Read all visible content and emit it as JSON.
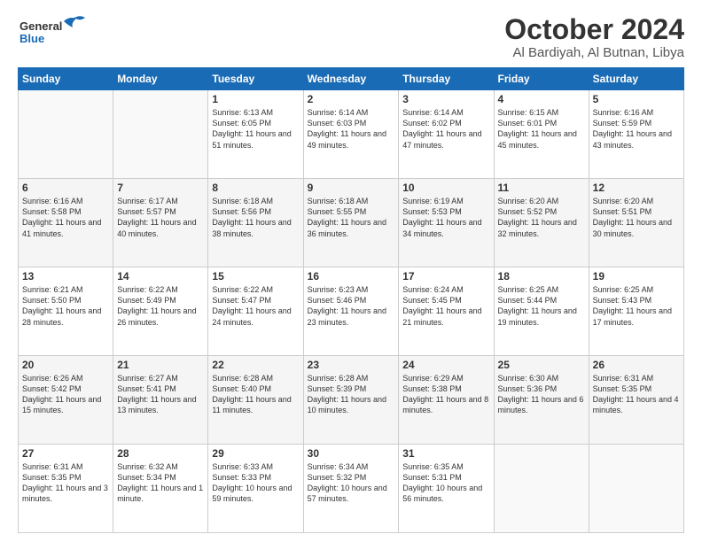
{
  "logo": {
    "line1": "General",
    "line2": "Blue",
    "icon": "▶"
  },
  "header": {
    "month": "October 2024",
    "location": "Al Bardiyah, Al Butnan, Libya"
  },
  "weekdays": [
    "Sunday",
    "Monday",
    "Tuesday",
    "Wednesday",
    "Thursday",
    "Friday",
    "Saturday"
  ],
  "weeks": [
    [
      {
        "day": "",
        "text": ""
      },
      {
        "day": "",
        "text": ""
      },
      {
        "day": "1",
        "text": "Sunrise: 6:13 AM\nSunset: 6:05 PM\nDaylight: 11 hours and 51 minutes."
      },
      {
        "day": "2",
        "text": "Sunrise: 6:14 AM\nSunset: 6:03 PM\nDaylight: 11 hours and 49 minutes."
      },
      {
        "day": "3",
        "text": "Sunrise: 6:14 AM\nSunset: 6:02 PM\nDaylight: 11 hours and 47 minutes."
      },
      {
        "day": "4",
        "text": "Sunrise: 6:15 AM\nSunset: 6:01 PM\nDaylight: 11 hours and 45 minutes."
      },
      {
        "day": "5",
        "text": "Sunrise: 6:16 AM\nSunset: 5:59 PM\nDaylight: 11 hours and 43 minutes."
      }
    ],
    [
      {
        "day": "6",
        "text": "Sunrise: 6:16 AM\nSunset: 5:58 PM\nDaylight: 11 hours and 41 minutes."
      },
      {
        "day": "7",
        "text": "Sunrise: 6:17 AM\nSunset: 5:57 PM\nDaylight: 11 hours and 40 minutes."
      },
      {
        "day": "8",
        "text": "Sunrise: 6:18 AM\nSunset: 5:56 PM\nDaylight: 11 hours and 38 minutes."
      },
      {
        "day": "9",
        "text": "Sunrise: 6:18 AM\nSunset: 5:55 PM\nDaylight: 11 hours and 36 minutes."
      },
      {
        "day": "10",
        "text": "Sunrise: 6:19 AM\nSunset: 5:53 PM\nDaylight: 11 hours and 34 minutes."
      },
      {
        "day": "11",
        "text": "Sunrise: 6:20 AM\nSunset: 5:52 PM\nDaylight: 11 hours and 32 minutes."
      },
      {
        "day": "12",
        "text": "Sunrise: 6:20 AM\nSunset: 5:51 PM\nDaylight: 11 hours and 30 minutes."
      }
    ],
    [
      {
        "day": "13",
        "text": "Sunrise: 6:21 AM\nSunset: 5:50 PM\nDaylight: 11 hours and 28 minutes."
      },
      {
        "day": "14",
        "text": "Sunrise: 6:22 AM\nSunset: 5:49 PM\nDaylight: 11 hours and 26 minutes."
      },
      {
        "day": "15",
        "text": "Sunrise: 6:22 AM\nSunset: 5:47 PM\nDaylight: 11 hours and 24 minutes."
      },
      {
        "day": "16",
        "text": "Sunrise: 6:23 AM\nSunset: 5:46 PM\nDaylight: 11 hours and 23 minutes."
      },
      {
        "day": "17",
        "text": "Sunrise: 6:24 AM\nSunset: 5:45 PM\nDaylight: 11 hours and 21 minutes."
      },
      {
        "day": "18",
        "text": "Sunrise: 6:25 AM\nSunset: 5:44 PM\nDaylight: 11 hours and 19 minutes."
      },
      {
        "day": "19",
        "text": "Sunrise: 6:25 AM\nSunset: 5:43 PM\nDaylight: 11 hours and 17 minutes."
      }
    ],
    [
      {
        "day": "20",
        "text": "Sunrise: 6:26 AM\nSunset: 5:42 PM\nDaylight: 11 hours and 15 minutes."
      },
      {
        "day": "21",
        "text": "Sunrise: 6:27 AM\nSunset: 5:41 PM\nDaylight: 11 hours and 13 minutes."
      },
      {
        "day": "22",
        "text": "Sunrise: 6:28 AM\nSunset: 5:40 PM\nDaylight: 11 hours and 11 minutes."
      },
      {
        "day": "23",
        "text": "Sunrise: 6:28 AM\nSunset: 5:39 PM\nDaylight: 11 hours and 10 minutes."
      },
      {
        "day": "24",
        "text": "Sunrise: 6:29 AM\nSunset: 5:38 PM\nDaylight: 11 hours and 8 minutes."
      },
      {
        "day": "25",
        "text": "Sunrise: 6:30 AM\nSunset: 5:36 PM\nDaylight: 11 hours and 6 minutes."
      },
      {
        "day": "26",
        "text": "Sunrise: 6:31 AM\nSunset: 5:35 PM\nDaylight: 11 hours and 4 minutes."
      }
    ],
    [
      {
        "day": "27",
        "text": "Sunrise: 6:31 AM\nSunset: 5:35 PM\nDaylight: 11 hours and 3 minutes."
      },
      {
        "day": "28",
        "text": "Sunrise: 6:32 AM\nSunset: 5:34 PM\nDaylight: 11 hours and 1 minute."
      },
      {
        "day": "29",
        "text": "Sunrise: 6:33 AM\nSunset: 5:33 PM\nDaylight: 10 hours and 59 minutes."
      },
      {
        "day": "30",
        "text": "Sunrise: 6:34 AM\nSunset: 5:32 PM\nDaylight: 10 hours and 57 minutes."
      },
      {
        "day": "31",
        "text": "Sunrise: 6:35 AM\nSunset: 5:31 PM\nDaylight: 10 hours and 56 minutes."
      },
      {
        "day": "",
        "text": ""
      },
      {
        "day": "",
        "text": ""
      }
    ]
  ]
}
